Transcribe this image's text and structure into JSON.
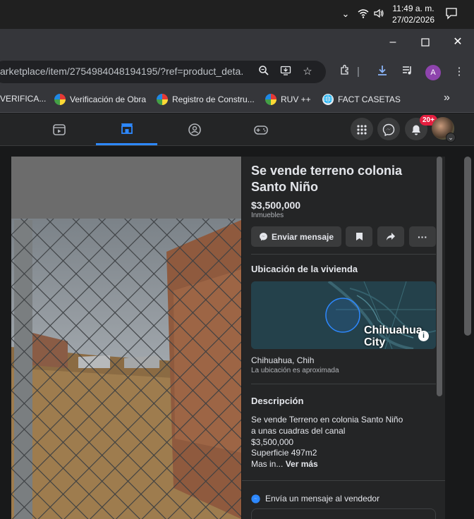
{
  "os": {
    "time": "11:49 a. m.",
    "date": "27/02/2026"
  },
  "browser": {
    "url": "arketplace/item/2754984048194195/?ref=product_deta...",
    "profile_initial": "A",
    "bookmarks": [
      {
        "label": "VERIFICA...",
        "icon": "bookmark-favicon"
      },
      {
        "label": "Verificación de Obra",
        "icon": "ruv-favicon"
      },
      {
        "label": "Registro de Constru...",
        "icon": "ruv-favicon"
      },
      {
        "label": "RUV ++",
        "icon": "ruv-favicon"
      },
      {
        "label": "FACT CASETAS",
        "icon": "globe-icon"
      }
    ],
    "more_bookmarks": "»"
  },
  "facebook": {
    "notification_count": "20+",
    "nav_tabs": [
      {
        "name": "watch",
        "icon": "video-icon",
        "active": false
      },
      {
        "name": "marketplace",
        "icon": "marketplace-icon",
        "active": true
      },
      {
        "name": "groups",
        "icon": "groups-icon",
        "active": false
      },
      {
        "name": "gaming",
        "icon": "gaming-icon",
        "active": false
      }
    ],
    "accent": "#2d88ff"
  },
  "listing": {
    "title": "Se vende terreno colonia Santo Niño",
    "price": "$3,500,000",
    "category": "Inmuebles",
    "send_message_label": "Enviar mensaje",
    "location_heading": "Ubicación de la vivienda",
    "map_city_label": "Chihuahua City",
    "location": "Chihuahua, Chih",
    "location_note": "La ubicación es aproximada",
    "description_heading": "Descripción",
    "description": "Se vende Terreno en colonia Santo Niño\na unas cuadras del canal\n$3,500,000\nSuperficie 497m2\nMas in... ",
    "see_more_label": "Ver más",
    "message_seller_label": "Envía un mensaje al vendedor"
  }
}
